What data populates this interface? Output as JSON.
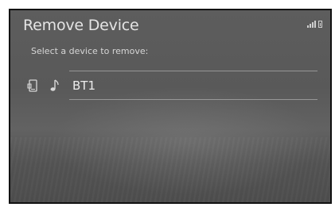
{
  "screen": {
    "title": "Remove Device",
    "subtitle": "Select a device to remove:"
  },
  "status_bar": {
    "icons": [
      "signal-icon",
      "battery-icon"
    ]
  },
  "devices": [
    {
      "name": "BT1",
      "icons": [
        "phone-icon",
        "music-icon"
      ]
    }
  ]
}
